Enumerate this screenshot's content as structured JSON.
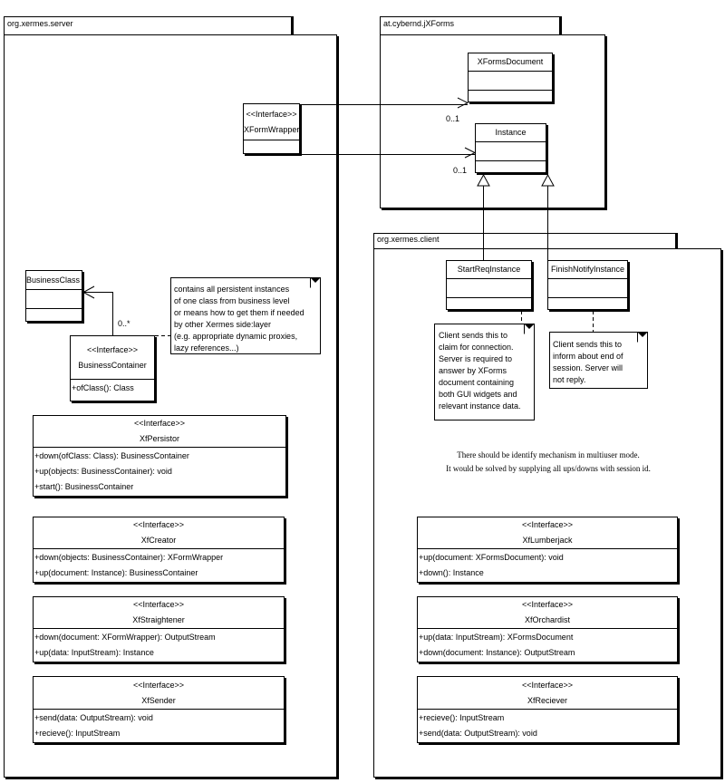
{
  "packages": {
    "server": "org.xermes.server",
    "jxforms": "at.cybernd.jXForms",
    "client": "org.xermes.client"
  },
  "classes": {
    "xformwrapper": {
      "stereotype": "<<Interface>>",
      "name": "XFormWrapper"
    },
    "xformsdocument": {
      "name": "XFormsDocument"
    },
    "instance": {
      "name": "Instance"
    },
    "startreq": {
      "name": "StartReqInstance"
    },
    "finishnotify": {
      "name": "FinishNotifyInstance"
    },
    "businessclass": {
      "name": "BusinessClass"
    },
    "businesscontainer": {
      "stereotype": "<<Interface>>",
      "name": "BusinessContainer",
      "ops": [
        "+ofClass(): Class"
      ]
    },
    "xfpersistor": {
      "stereotype": "<<Interface>>",
      "name": "XfPersistor",
      "ops": [
        "+down(ofClass: Class): BusinessContainer",
        "+up(objects: BusinessContainer): void",
        "+start(): BusinessContainer"
      ]
    },
    "xfcreator": {
      "stereotype": "<<Interface>>",
      "name": "XfCreator",
      "ops": [
        "+down(objects: BusinessContainer): XFormWrapper",
        "+up(document: Instance): BusinessContainer"
      ]
    },
    "xfstraightener": {
      "stereotype": "<<Interface>>",
      "name": "XfStraightener",
      "ops": [
        "+down(document: XFormWrapper): OutputStream",
        "+up(data: InputStream): Instance"
      ]
    },
    "xfsender": {
      "stereotype": "<<Interface>>",
      "name": "XfSender",
      "ops": [
        "+send(data: OutputStream): void",
        "+recieve(): InputStream"
      ]
    },
    "xflumberjack": {
      "stereotype": "<<Interface>>",
      "name": "XfLumberjack",
      "ops": [
        "+up(document: XFormsDocument): void",
        "+down(): Instance"
      ]
    },
    "xforchardist": {
      "stereotype": "<<Interface>>",
      "name": "XfOrchardist",
      "ops": [
        "+up(data: InputStream): XFormsDocument",
        "+down(document: Instance): OutputStream"
      ]
    },
    "xfreciever": {
      "stereotype": "<<Interface>>",
      "name": "XfReciever",
      "ops": [
        "+recieve(): InputStream",
        "+send(data: OutputStream): void"
      ]
    }
  },
  "multiplicities": {
    "doc": "0..1",
    "inst": "0..1",
    "business": "0..*"
  },
  "notes": {
    "business": [
      "contains all persistent instances",
      "of one class from business level",
      "or means how to get them if needed",
      "by other Xermes side:layer",
      "(e.g. appropriate dynamic proxies,",
      "lazy references...)"
    ],
    "startreq": [
      "Client sends this to",
      "claim for connection.",
      "Server is required to",
      "answer by XForms",
      "document containing",
      "both GUI widgets and",
      "relevant instance data."
    ],
    "finish": [
      "Client sends this to",
      "inform about end of",
      "session. Server will",
      "not reply."
    ]
  },
  "remark": [
    "There should be identify mechanism in multiuser mode.",
    "It would be solved by supplying all ups/downs with session id."
  ]
}
